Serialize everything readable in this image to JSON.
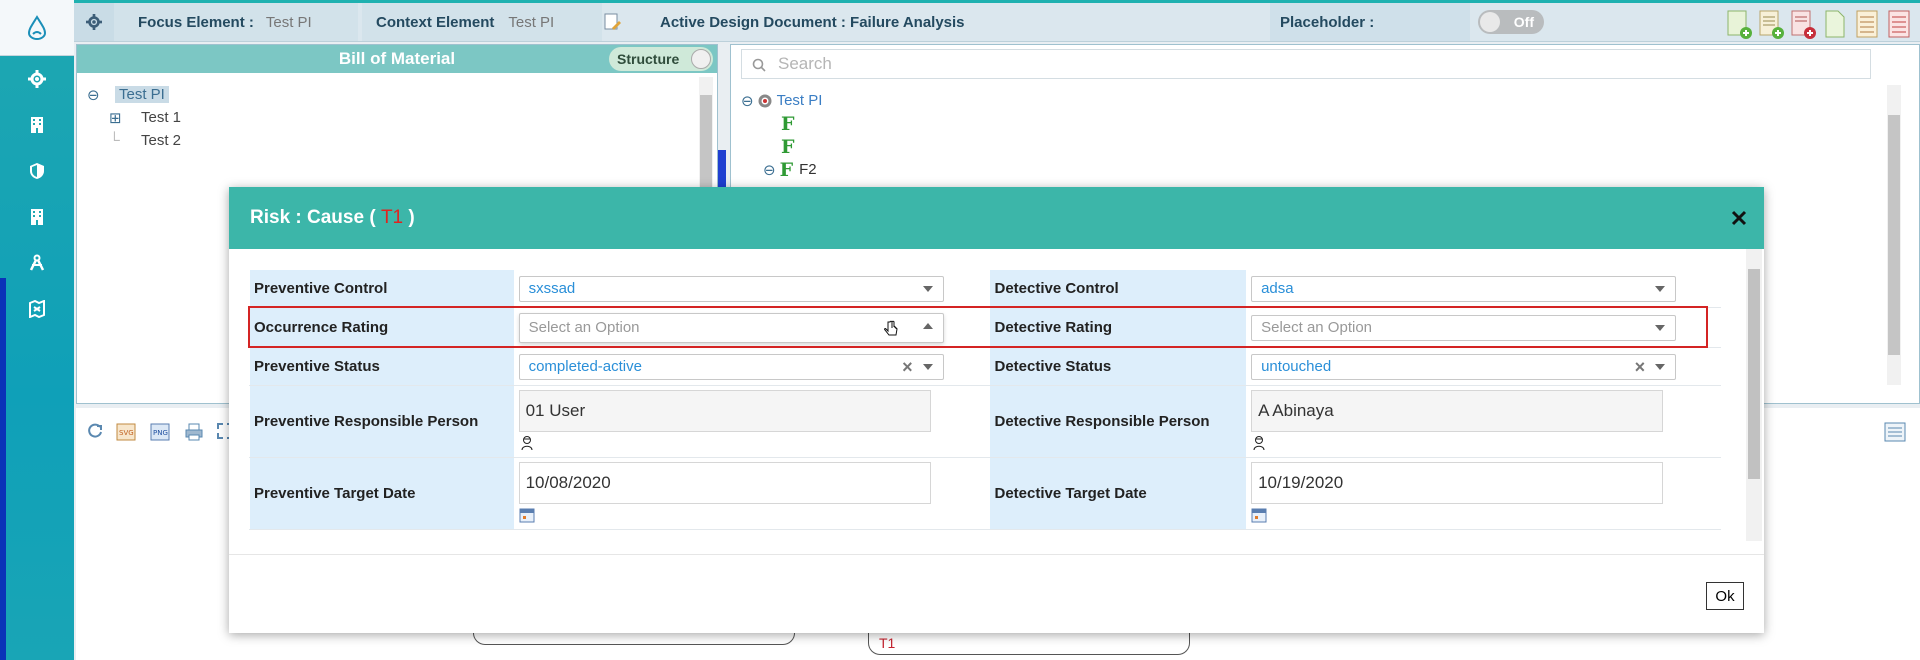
{
  "topbar": {
    "focus_label": "Focus Element :",
    "focus_value": "Test PI",
    "context_label": "Context Element",
    "context_value": "Test PI",
    "active_doc": "Active Design Document : Failure Analysis",
    "placeholder_label": "Placeholder :",
    "toggle_value": "Off"
  },
  "bom": {
    "title": "Bill of Material",
    "structure_label": "Structure",
    "tree": [
      "Test PI",
      "Test 1",
      "Test 2"
    ]
  },
  "right_panel": {
    "search_placeholder": "Search",
    "root": "Test PI",
    "f_rows": [
      "F",
      "F",
      "F"
    ],
    "f2_label": "F2"
  },
  "modal": {
    "title_prefix": "Risk : Cause ( ",
    "title_ref": "T1",
    "title_suffix": " )",
    "rows": {
      "preventive_control_label": "Preventive Control",
      "preventive_control_value": "sxssad",
      "detective_control_label": "Detective Control",
      "detective_control_value": "adsa",
      "occurrence_rating_label": "Occurrence Rating",
      "occurrence_rating_placeholder": "Select an Option",
      "detective_rating_label": "Detective Rating",
      "detective_rating_placeholder": "Select an Option",
      "preventive_status_label": "Preventive Status",
      "preventive_status_value": "completed-active",
      "detective_status_label": "Detective Status",
      "detective_status_value": "untouched",
      "preventive_person_label": "Preventive Responsible Person",
      "preventive_person_value": "01 User",
      "detective_person_label": "Detective Responsible Person",
      "detective_person_value": "A Abinaya",
      "preventive_date_label": "Preventive Target Date",
      "preventive_date_value": "10/08/2020",
      "detective_date_label": "Detective Target Date",
      "detective_date_value": "10/19/2020"
    },
    "ok_label": "Ok"
  },
  "behind": {
    "t1": "T1"
  },
  "colors": {
    "accent": "#3cb6a9",
    "highlight": "#d42424",
    "nav": "#1fa7b1"
  }
}
